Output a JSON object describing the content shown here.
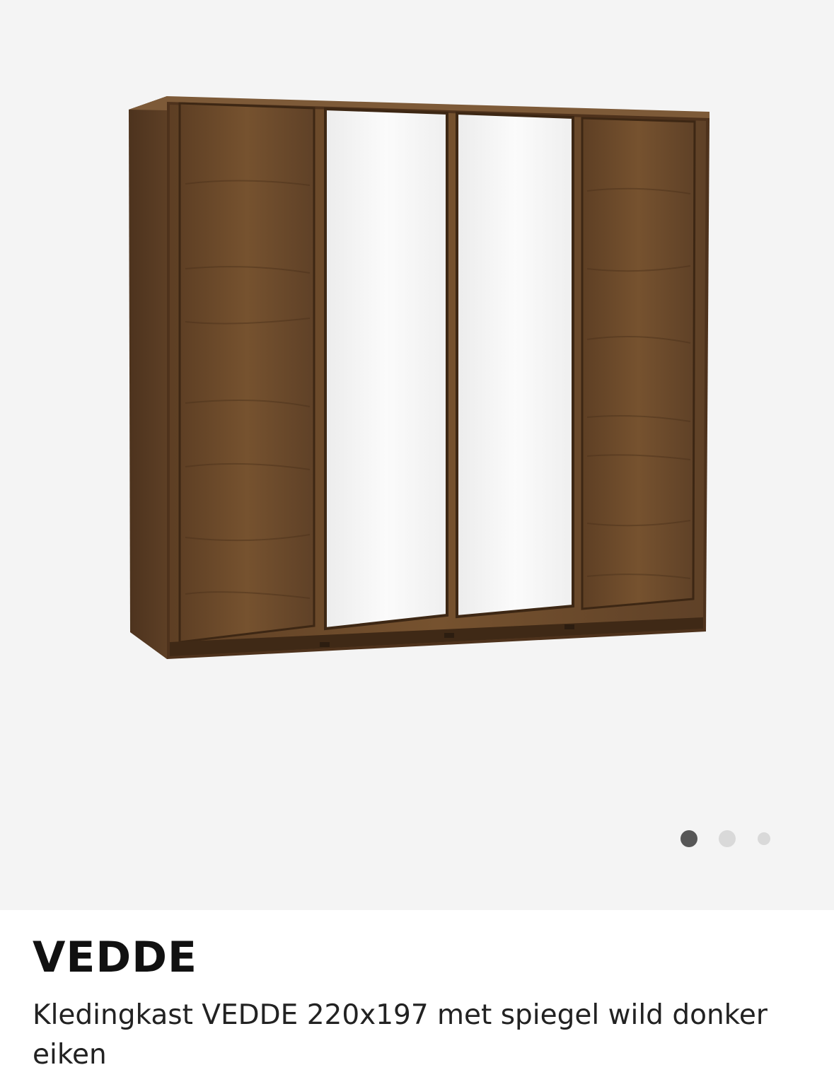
{
  "gallery": {
    "image_alt": "Kledingkast VEDDE",
    "slide_count": 3,
    "active_slide": 1
  },
  "product": {
    "name": "VEDDE",
    "description": "Kledingkast VEDDE 220x197 met spiegel wild donker eiken"
  },
  "colors": {
    "gallery_bg": "#f4f4f4",
    "wood": "#6b4a2c",
    "mirror": "#f7f7f7",
    "dot_active": "#575757",
    "dot_inactive": "#d9d9d9"
  }
}
